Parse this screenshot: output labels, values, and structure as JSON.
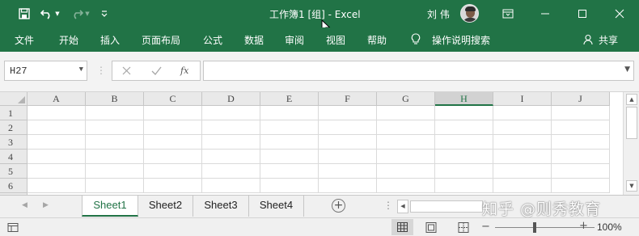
{
  "window": {
    "title": "工作簿1  [组]  -  Excel",
    "user_name": "刘 伟"
  },
  "menu": {
    "tabs": [
      "文件",
      "开始",
      "插入",
      "页面布局",
      "公式",
      "数据",
      "审阅",
      "视图",
      "帮助"
    ],
    "tell_me": "操作说明搜索",
    "share": "共享"
  },
  "formula_bar": {
    "name_box": "H27",
    "fx_label": "fx",
    "formula": ""
  },
  "grid": {
    "columns": [
      "A",
      "B",
      "C",
      "D",
      "E",
      "F",
      "G",
      "H",
      "I",
      "J"
    ],
    "selected_column": "H",
    "rows": [
      "1",
      "2",
      "3",
      "4",
      "5",
      "6"
    ]
  },
  "sheets": {
    "tabs": [
      "Sheet1",
      "Sheet2",
      "Sheet3",
      "Sheet4"
    ],
    "active": "Sheet1",
    "add_label": "+",
    "dots": "⋮"
  },
  "watermark": "知乎 @则秀教育",
  "status": {
    "zoom_minus": "−",
    "zoom_plus": "+",
    "zoom": "100%",
    "zoom_value": 100
  },
  "colors": {
    "brand": "#217346",
    "grid_line": "#dadada",
    "header_bg": "#e9e9e9"
  }
}
